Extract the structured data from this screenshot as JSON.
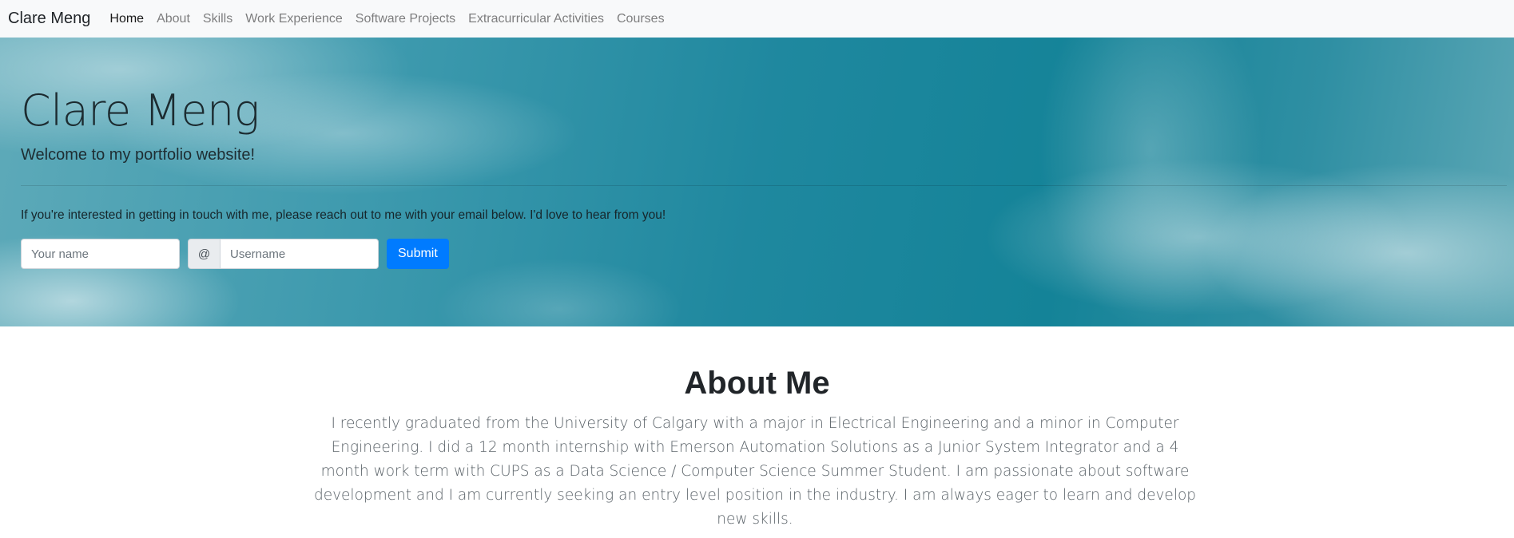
{
  "navbar": {
    "brand": "Clare Meng",
    "links": [
      {
        "label": "Home",
        "active": true
      },
      {
        "label": "About",
        "active": false
      },
      {
        "label": "Skills",
        "active": false
      },
      {
        "label": "Work Experience",
        "active": false
      },
      {
        "label": "Software Projects",
        "active": false
      },
      {
        "label": "Extracurricular Activities",
        "active": false
      },
      {
        "label": "Courses",
        "active": false
      }
    ]
  },
  "hero": {
    "title": "Clare Meng",
    "lead": "Welcome to my portfolio website!",
    "contact_text": "If you're interested in getting in touch with me, please reach out to me with your email below. I'd love to hear from you!",
    "form": {
      "name_placeholder": "Your name",
      "name_value": "",
      "at_symbol": "@",
      "username_placeholder": "Username",
      "username_value": "",
      "submit_label": "Submit"
    }
  },
  "about": {
    "heading": "About Me",
    "body": "I recently graduated from the University of Calgary with a major in Electrical Engineering and a minor in Computer Engineering. I did a 12 month internship with Emerson Automation Solutions as a Junior System Integrator and a 4 month work term with CUPS as a Data Science / Computer Science Summer Student. I am passionate about software development and I am currently seeking an entry level position in the industry. I am always eager to learn and develop new skills."
  },
  "colors": {
    "navbar_bg": "#f8f9fa",
    "primary": "#007bff",
    "hero_sky": "#1f889f"
  }
}
